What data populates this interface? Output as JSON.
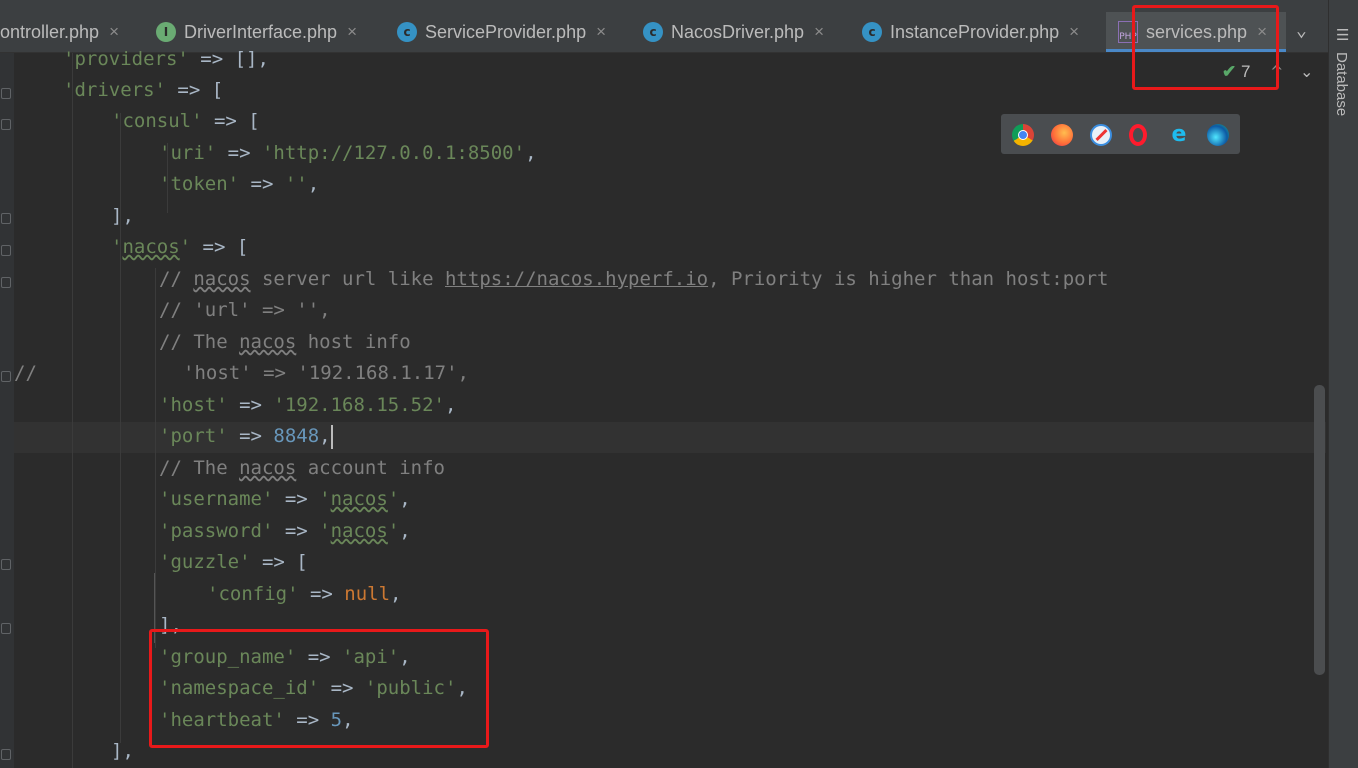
{
  "tabs": [
    {
      "label": "ontroller.php",
      "icon": "php-class-icon",
      "close": "×"
    },
    {
      "label": "DriverInterface.php",
      "icon": "interface-icon",
      "close": "×"
    },
    {
      "label": "ServiceProvider.php",
      "icon": "class-icon",
      "close": "×"
    },
    {
      "label": "NacosDriver.php",
      "icon": "class-icon",
      "close": "×"
    },
    {
      "label": "InstanceProvider.php",
      "icon": "class-icon",
      "close": "×"
    },
    {
      "label": "services.php",
      "icon": "php-file-icon",
      "close": "×",
      "active": true
    }
  ],
  "tab_overflow": "⌄",
  "inspection": {
    "count": "7",
    "up": "^",
    "down": "⌄"
  },
  "tool_window": {
    "label": "Database"
  },
  "code": {
    "l1": [
      "'providers'",
      " => [],"
    ],
    "l2": [
      "'drivers'",
      " => ["
    ],
    "l3": [
      "'consul'",
      " => ["
    ],
    "l4": [
      "'uri'",
      " => ",
      "'http://127.0.0.1:8500'",
      ","
    ],
    "l5": [
      "'token'",
      " => ",
      "''",
      ","
    ],
    "l6": "],",
    "l7": [
      "'",
      "nacos",
      "'",
      " => ["
    ],
    "l8": [
      "// ",
      "nacos",
      " server url like ",
      "https://nacos.hyperf.io",
      ", Priority is higher than host:port"
    ],
    "l9": "// 'url' => '',",
    "l10": [
      "// The ",
      "nacos",
      " host info"
    ],
    "l11": [
      "//",
      "'host' => '192.168.1.17',"
    ],
    "l12": [
      "'host'",
      " => ",
      "'192.168.15.52'",
      ","
    ],
    "l13": [
      "'port'",
      " => ",
      "8848",
      ","
    ],
    "l14": [
      "// The ",
      "nacos",
      " account info"
    ],
    "l15": [
      "'username'",
      " => ",
      "'",
      "nacos",
      "'",
      ","
    ],
    "l16": [
      "'password'",
      " => ",
      "'",
      "nacos",
      "'",
      ","
    ],
    "l17": [
      "'guzzle'",
      " => ["
    ],
    "l18": [
      "'config'",
      " => ",
      "null",
      ","
    ],
    "l19": "],",
    "l20": [
      "'group_name'",
      " => ",
      "'api'",
      ","
    ],
    "l21": [
      "'namespace_id'",
      " => ",
      "'public'",
      ","
    ],
    "l22": [
      "'heartbeat'",
      " => ",
      "5",
      ","
    ],
    "l23": "],"
  },
  "browsers": [
    "chrome-icon",
    "firefox-icon",
    "safari-icon",
    "opera-icon",
    "ie-icon",
    "edge-icon"
  ],
  "colors": {
    "highlight": "#e8191a",
    "string": "#6a8759",
    "number": "#6897bb",
    "keyword": "#cc7832",
    "comment": "#808080"
  }
}
